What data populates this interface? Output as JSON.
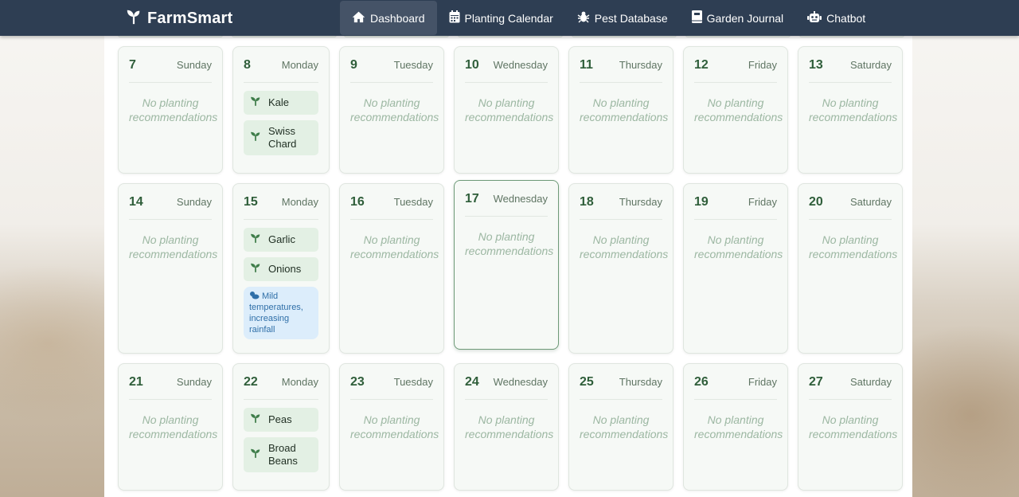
{
  "brand": {
    "name": "FarmSmart"
  },
  "nav": {
    "items": [
      {
        "label": "Dashboard",
        "icon": "home-icon"
      },
      {
        "label": "Planting Calendar",
        "icon": "calendar-icon"
      },
      {
        "label": "Pest Database",
        "icon": "bug-icon"
      },
      {
        "label": "Garden Journal",
        "icon": "journal-icon"
      },
      {
        "label": "Chatbot",
        "icon": "robot-icon"
      }
    ]
  },
  "calendar": {
    "empty_text": "No planting recommendations",
    "weeks": [
      [
        {
          "num": "7",
          "name": "Sunday"
        },
        {
          "num": "8",
          "name": "Monday",
          "crops": [
            "Kale",
            "Swiss Chard"
          ]
        },
        {
          "num": "9",
          "name": "Tuesday"
        },
        {
          "num": "10",
          "name": "Wednesday"
        },
        {
          "num": "11",
          "name": "Thursday"
        },
        {
          "num": "12",
          "name": "Friday"
        },
        {
          "num": "13",
          "name": "Saturday"
        }
      ],
      [
        {
          "num": "14",
          "name": "Sunday"
        },
        {
          "num": "15",
          "name": "Monday",
          "crops": [
            "Garlic",
            "Onions"
          ],
          "weather": "Mild temperatures, increasing rainfall"
        },
        {
          "num": "16",
          "name": "Tuesday"
        },
        {
          "num": "17",
          "name": "Wednesday",
          "today": true
        },
        {
          "num": "18",
          "name": "Thursday"
        },
        {
          "num": "19",
          "name": "Friday"
        },
        {
          "num": "20",
          "name": "Saturday"
        }
      ],
      [
        {
          "num": "21",
          "name": "Sunday"
        },
        {
          "num": "22",
          "name": "Monday",
          "crops": [
            "Peas",
            "Broad Beans"
          ]
        },
        {
          "num": "23",
          "name": "Tuesday"
        },
        {
          "num": "24",
          "name": "Wednesday"
        },
        {
          "num": "25",
          "name": "Thursday"
        },
        {
          "num": "26",
          "name": "Friday"
        },
        {
          "num": "27",
          "name": "Saturday"
        }
      ]
    ]
  },
  "colors": {
    "navbar": "#2e3e53",
    "accent": "#2f5e3a",
    "crop_bg": "#e3f0e4",
    "weather_bg": "#dcedfb"
  }
}
